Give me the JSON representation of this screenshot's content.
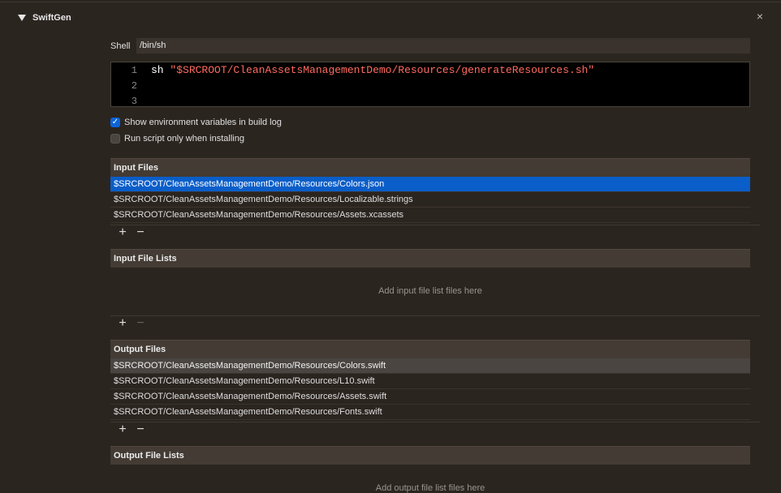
{
  "phase": {
    "title": "SwiftGen",
    "close_glyph": "×"
  },
  "shell": {
    "label": "Shell",
    "value": "/bin/sh"
  },
  "script": {
    "lines": [
      {
        "num": "1",
        "cmd": "sh",
        "arg": "\"$SRCROOT/CleanAssetsManagementDemo/Resources/generateResources.sh\""
      },
      {
        "num": "2",
        "cmd": "",
        "arg": ""
      },
      {
        "num": "3",
        "cmd": "",
        "arg": ""
      }
    ]
  },
  "options": {
    "show_env": {
      "label": "Show environment variables in build log",
      "checked": true
    },
    "run_installing": {
      "label": "Run script only when installing",
      "checked": false
    }
  },
  "input_files": {
    "title": "Input Files",
    "rows": [
      "$SRCROOT/CleanAssetsManagementDemo/Resources/Colors.json",
      "$SRCROOT/CleanAssetsManagementDemo/Resources/Localizable.strings",
      "$SRCROOT/CleanAssetsManagementDemo/Resources/Assets.xcassets"
    ]
  },
  "input_file_lists": {
    "title": "Input File Lists",
    "placeholder": "Add input file list files here"
  },
  "output_files": {
    "title": "Output Files",
    "rows": [
      "$SRCROOT/CleanAssetsManagementDemo/Resources/Colors.swift",
      "$SRCROOT/CleanAssetsManagementDemo/Resources/L10.swift",
      "$SRCROOT/CleanAssetsManagementDemo/Resources/Assets.swift",
      "$SRCROOT/CleanAssetsManagementDemo/Resources/Fonts.swift"
    ]
  },
  "output_file_lists": {
    "title": "Output File Lists",
    "placeholder": "Add output file list files here"
  },
  "controls": {
    "plus": "+",
    "minus": "−"
  },
  "colors": {
    "selection_blue": "#0a5ec9",
    "selection_gray": "#4a4541",
    "string_red": "#ff6b5f",
    "checkbox_blue": "#0b64d8"
  }
}
